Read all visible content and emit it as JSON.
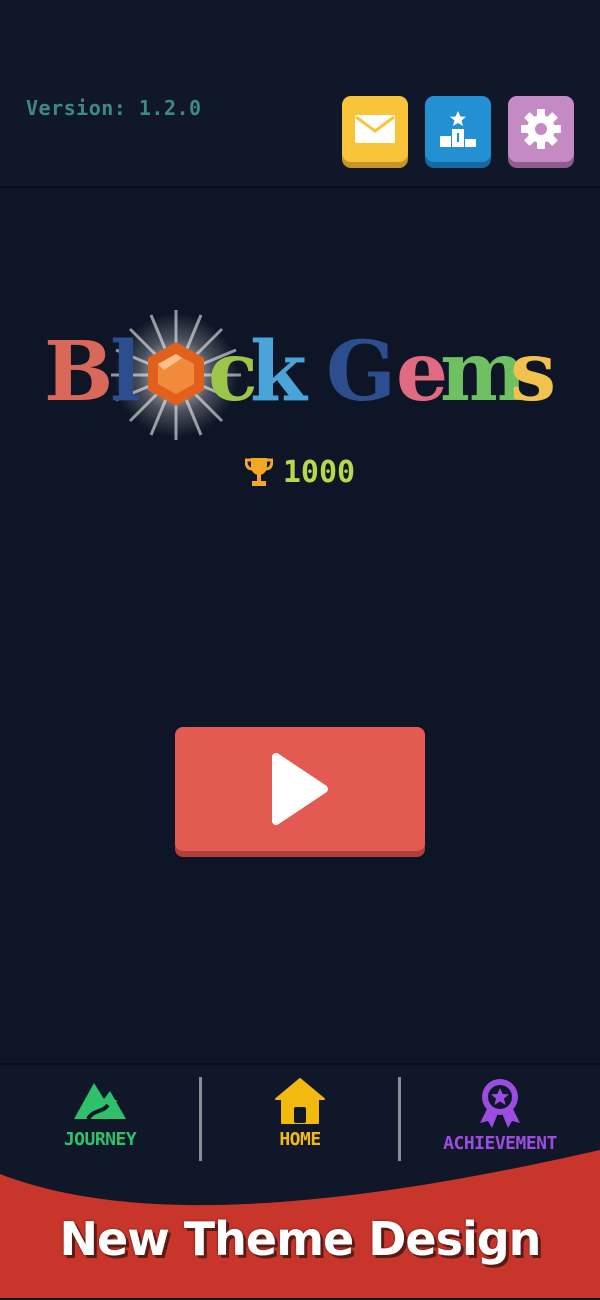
{
  "header": {
    "version": "Version: 1.2.0",
    "buttons": [
      {
        "name": "mail",
        "icon": "mail-icon",
        "color": "#f8c43a"
      },
      {
        "name": "leaderboard",
        "icon": "podium-icon",
        "color": "#2390d4"
      },
      {
        "name": "settings",
        "icon": "gear-icon",
        "color": "#c58ac3"
      }
    ]
  },
  "logo": {
    "title": "Block Gems",
    "letters": [
      "B",
      "l",
      "o",
      "c",
      "k",
      "G",
      "e",
      "m",
      "s"
    ],
    "colors": [
      "#d9675a",
      "#2c4e8f",
      "#e0611e",
      "#9bc64a",
      "#4aa3d9",
      "#2c4e8f",
      "#e06a80",
      "#6fbf63",
      "#f2c14e"
    ]
  },
  "score": {
    "icon": "trophy-icon",
    "value": "1000"
  },
  "play": {
    "icon": "play-icon",
    "color": "#e25a52"
  },
  "nav": [
    {
      "label": "JOURNEY",
      "icon": "mountain-icon",
      "color": "#2fc16a"
    },
    {
      "label": "HOME",
      "icon": "house-icon",
      "color": "#f2b90e"
    },
    {
      "label": "ACHIEVEMENT",
      "icon": "medal-icon",
      "color": "#9b4de2"
    }
  ],
  "banner": {
    "text": "New Theme Design",
    "color": "#c8352a"
  }
}
